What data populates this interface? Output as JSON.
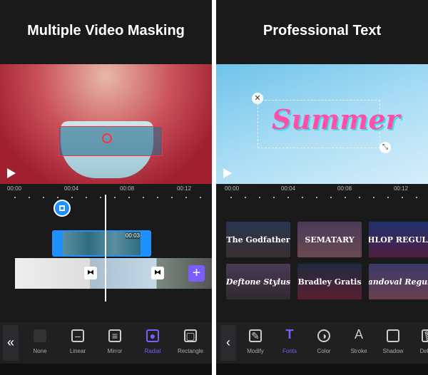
{
  "left": {
    "title": "Multiple Video Masking",
    "ruler": [
      "00:00",
      "00:04",
      "00:08",
      "00:12"
    ],
    "clip_duration": "00:03",
    "tools": [
      {
        "label": "None",
        "icon": "none-icon"
      },
      {
        "label": "Linear",
        "icon": "linear-mask-icon"
      },
      {
        "label": "Mirror",
        "icon": "mirror-mask-icon"
      },
      {
        "label": "Radial",
        "icon": "radial-mask-icon",
        "active": true
      },
      {
        "label": "Rectangle",
        "icon": "rectangle-mask-icon"
      }
    ]
  },
  "right": {
    "title": "Professional Text",
    "sticker_text": "Summer",
    "ruler": [
      "00:00",
      "00:04",
      "00:08",
      "00:12"
    ],
    "fonts": [
      "The Godfather",
      "SEMATARY",
      "SHLOP REGULAR",
      "Deftone Stylus",
      "Bradley Gratis",
      "Sandoval Regular"
    ],
    "tools": [
      {
        "label": "Modify",
        "icon": "edit-icon"
      },
      {
        "label": "Fonts",
        "icon": "text-icon",
        "active": true
      },
      {
        "label": "Color",
        "icon": "color-icon"
      },
      {
        "label": "Stroke",
        "icon": "stroke-icon"
      },
      {
        "label": "Shadow",
        "icon": "shadow-icon"
      },
      {
        "label": "Delete",
        "icon": "delete-icon"
      }
    ]
  },
  "colors": {
    "accent": "#7b5cff",
    "clip": "#1e90ff"
  }
}
